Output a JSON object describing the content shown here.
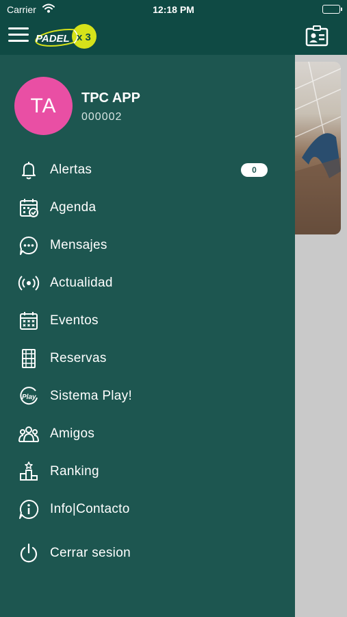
{
  "status_bar": {
    "carrier": "Carrier",
    "time": "12:18 PM"
  },
  "header": {
    "logo_text": "PADEL",
    "logo_suffix": "x 3",
    "menu_icon": "hamburger-menu-icon",
    "profile_card_icon": "id-card-icon"
  },
  "profile": {
    "initials": "TA",
    "name": "TPC APP",
    "id": "000002"
  },
  "menu": {
    "items": [
      {
        "label": "Alertas",
        "icon": "bell-icon",
        "badge": "0"
      },
      {
        "label": "Agenda",
        "icon": "calendar-check-icon"
      },
      {
        "label": "Mensajes",
        "icon": "chat-bubble-icon"
      },
      {
        "label": "Actualidad",
        "icon": "broadcast-icon"
      },
      {
        "label": "Eventos",
        "icon": "calendar-grid-icon"
      },
      {
        "label": "Reservas",
        "icon": "court-icon"
      },
      {
        "label": "Sistema Play!",
        "icon": "play-badge-icon"
      },
      {
        "label": "Amigos",
        "icon": "group-icon"
      },
      {
        "label": "Ranking",
        "icon": "podium-icon"
      },
      {
        "label": "Info|Contacto",
        "icon": "info-icon"
      },
      {
        "label": "Cerrar sesion",
        "icon": "power-icon"
      }
    ]
  },
  "colors": {
    "header": "#0f4a44",
    "drawer": "#1d5650",
    "avatar": "#e94fa4",
    "logo_ball": "#d6e21a"
  }
}
